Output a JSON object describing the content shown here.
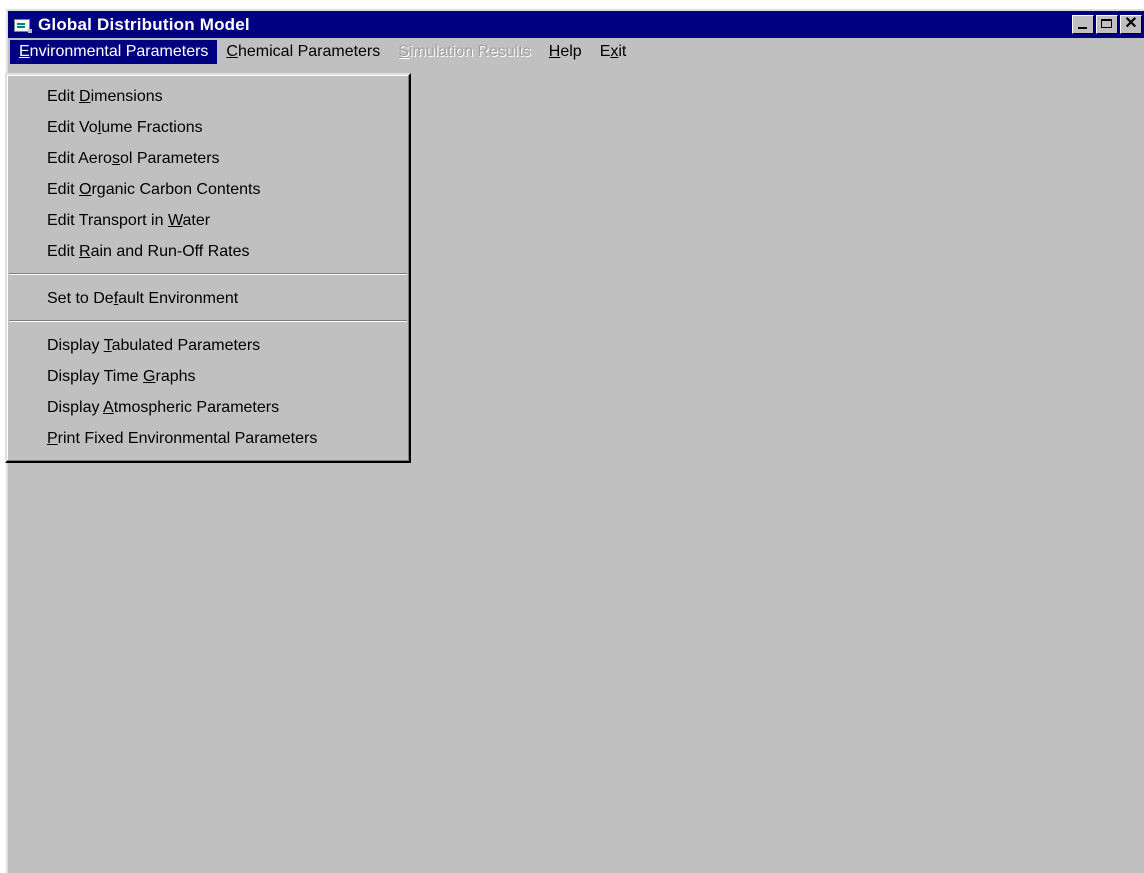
{
  "window": {
    "title": "Global Distribution Model"
  },
  "menubar": {
    "items": [
      {
        "pre": "",
        "key": "E",
        "post": "nvironmental Parameters",
        "state": "active"
      },
      {
        "pre": "",
        "key": "C",
        "post": "hemical Parameters",
        "state": "normal"
      },
      {
        "pre": "",
        "key": "S",
        "post": "imulation Results",
        "state": "disabled"
      },
      {
        "pre": "",
        "key": "H",
        "post": "elp",
        "state": "normal"
      },
      {
        "pre": "E",
        "key": "x",
        "post": "it",
        "state": "normal"
      }
    ]
  },
  "dropdown": {
    "groups": [
      [
        {
          "pre": "Edit ",
          "key": "D",
          "post": "imensions"
        },
        {
          "pre": "Edit Vo",
          "key": "l",
          "post": "ume Fractions"
        },
        {
          "pre": "Edit Aero",
          "key": "s",
          "post": "ol Parameters"
        },
        {
          "pre": "Edit ",
          "key": "O",
          "post": "rganic Carbon Contents"
        },
        {
          "pre": "Edit Transport in ",
          "key": "W",
          "post": "ater"
        },
        {
          "pre": "Edit ",
          "key": "R",
          "post": "ain and Run-Off Rates"
        }
      ],
      [
        {
          "pre": "Set to De",
          "key": "f",
          "post": "ault Environment"
        }
      ],
      [
        {
          "pre": "Display ",
          "key": "T",
          "post": "abulated Parameters"
        },
        {
          "pre": "Display Time ",
          "key": "G",
          "post": "raphs"
        },
        {
          "pre": "Display ",
          "key": "A",
          "post": "tmospheric Parameters"
        },
        {
          "pre": "",
          "key": "P",
          "post": "rint Fixed Environmental Parameters"
        }
      ]
    ]
  },
  "colors": {
    "titlebar": "#000080",
    "face": "#c0c0c0",
    "highlight_text": "#ffffff",
    "disabled_text": "#a0a0a0"
  },
  "icons": {
    "app": "app-window-icon",
    "minimize": "minimize-icon",
    "maximize": "maximize-icon",
    "close": "close-icon"
  }
}
